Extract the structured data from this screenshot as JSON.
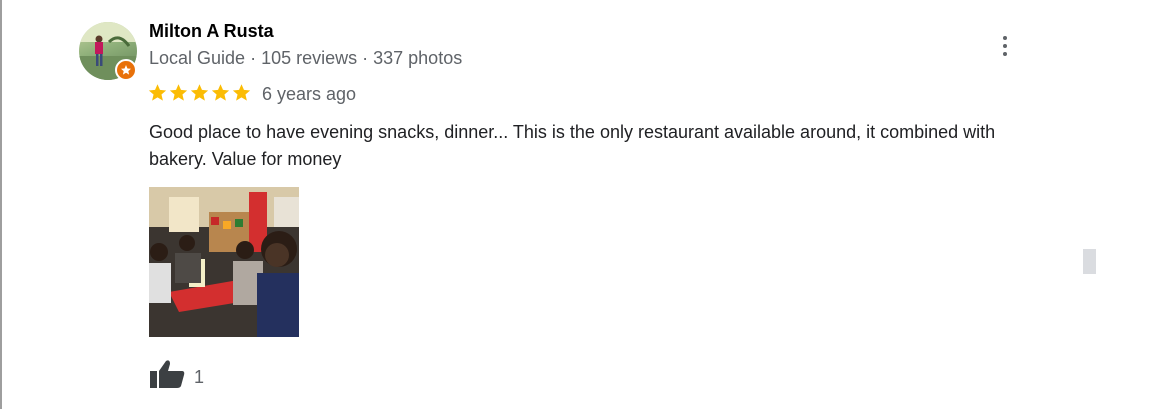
{
  "review": {
    "author_name": "Milton A Rusta",
    "author_level": "Local Guide",
    "reviews_count": "105 reviews",
    "photos_count": "337 photos",
    "separator": "·",
    "rating": 5,
    "rating_max": 5,
    "date": "6 years ago",
    "text": "Good place to have evening snacks, dinner... This is the only restaurant available around, it combined with bakery. Value for money",
    "like_count": "1"
  },
  "icons": {
    "more": "more-vert-icon",
    "like": "thumb-up-icon",
    "star": "star-icon",
    "badge": "local-guide-badge-icon"
  },
  "colors": {
    "star": "#fbbc04",
    "badge": "#e8710a",
    "text_secondary": "#5f6368",
    "text_primary": "#202124"
  }
}
